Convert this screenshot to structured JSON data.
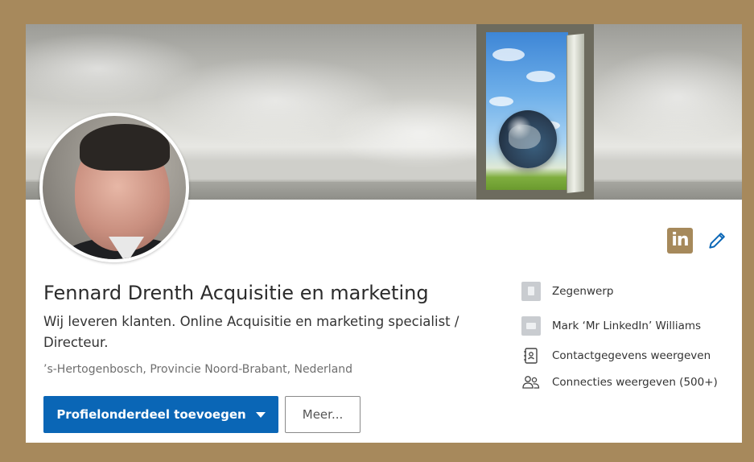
{
  "profile": {
    "name": "Fennard Drenth Acquisitie en marketing",
    "headline": "Wij leveren klanten. Online Acquisitie en marketing specialist / Directeur.",
    "location": "’s-Hertogenbosch, Provincie Noord-Brabant, Nederland"
  },
  "actions": {
    "primary_label": "Profielonderdeel toevoegen",
    "more_label": "Meer..."
  },
  "badges": {
    "linkedin_logo_text": "in",
    "edit_icon": "pencil-icon"
  },
  "info": {
    "items": [
      {
        "label": "Zegenwerp",
        "icon": "building-icon"
      },
      {
        "label": "Mark ‘Mr LinkedIn’ Williams",
        "icon": "school-icon"
      },
      {
        "label": "Contactgegevens weergeven",
        "icon": "contact-card-icon"
      },
      {
        "label": "Connecties weergeven (500+)",
        "icon": "people-icon"
      }
    ]
  },
  "colors": {
    "frame": "#a7895c",
    "primary_button": "#0a66b6",
    "linkedin_logo": "#a6895b",
    "edit_icon": "#0a66b6"
  }
}
